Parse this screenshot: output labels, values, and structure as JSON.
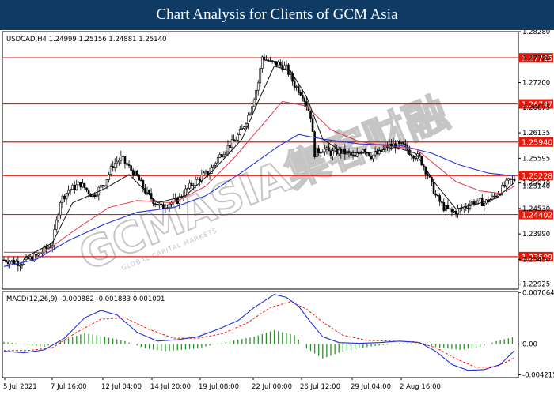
{
  "banner": {
    "title": "Chart Analysis for Clients of GCM Asia"
  },
  "watermark": {
    "brand": "GCMASIA集客财融",
    "tagline": "GLOBAL CAPITAL MARKETS"
  },
  "colors": {
    "banner_bg": "#0e3a63",
    "level_line": "#e8190b",
    "level_label_bg": "#e8190b",
    "ma_fast": "#111111",
    "ma_mid": "#e0364a",
    "ma_slow": "#2233dd",
    "macd_line": "#1e2fd9",
    "signal_line": "#e8190b",
    "histogram": "#1f9a1f",
    "candle": "#000000"
  },
  "chart_data": [
    {
      "type": "candlestick",
      "title": "USDCAD,H4",
      "info": "USDCAD,H4  1.24999 1.25156 1.24881 1.25140",
      "y_ticks": [
        "1.28280",
        "1.27720",
        "1.27200",
        "1.26675",
        "1.26135",
        "1.25595",
        "1.25070",
        "1.24530",
        "1.23990",
        "1.23450",
        "1.22925"
      ],
      "ylim": [
        1.2282,
        1.2828
      ],
      "x_ticks": [
        "5 Jul 2021",
        "7 Jul 16:00",
        "12 Jul 04:00",
        "14 Jul 20:00",
        "19 Jul 08:00",
        "22 Jul 00:00",
        "26 Jul 12:00",
        "29 Jul 04:00",
        "2 Aug 16:00"
      ],
      "levels": [
        {
          "label": "1.27725",
          "value": 1.27725
        },
        {
          "label": "1.26747",
          "value": 1.26747
        },
        {
          "label": "1.25940",
          "value": 1.2594
        },
        {
          "label": "1.25228",
          "value": 1.25228
        },
        {
          "label": "1.24402",
          "value": 1.24402
        },
        {
          "label": "1.23509",
          "value": 1.23509
        }
      ],
      "current_price_label": "1.25140",
      "close_path": [
        [
          0,
          1.2344
        ],
        [
          8,
          1.2338
        ],
        [
          16,
          1.2352
        ],
        [
          24,
          1.2378
        ],
        [
          28,
          1.247
        ],
        [
          32,
          1.2492
        ],
        [
          38,
          1.2505
        ],
        [
          44,
          1.248
        ],
        [
          50,
          1.2508
        ],
        [
          54,
          1.2545
        ],
        [
          58,
          1.256
        ],
        [
          62,
          1.254
        ],
        [
          66,
          1.252
        ],
        [
          70,
          1.249
        ],
        [
          74,
          1.247
        ],
        [
          78,
          1.2455
        ],
        [
          82,
          1.2465
        ],
        [
          86,
          1.247
        ],
        [
          90,
          1.249
        ],
        [
          94,
          1.2508
        ],
        [
          98,
          1.252
        ],
        [
          102,
          1.253
        ],
        [
          106,
          1.256
        ],
        [
          110,
          1.258
        ],
        [
          114,
          1.2595
        ],
        [
          118,
          1.262
        ],
        [
          122,
          1.266
        ],
        [
          126,
          1.272
        ],
        [
          128,
          1.2775
        ],
        [
          132,
          1.2762
        ],
        [
          136,
          1.276
        ],
        [
          140,
          1.275
        ],
        [
          144,
          1.2715
        ],
        [
          148,
          1.2695
        ],
        [
          152,
          1.265
        ],
        [
          154,
          1.257
        ],
        [
          158,
          1.258
        ],
        [
          162,
          1.257
        ],
        [
          166,
          1.2575
        ],
        [
          170,
          1.257
        ],
        [
          174,
          1.256
        ],
        [
          178,
          1.2582
        ],
        [
          182,
          1.2565
        ],
        [
          186,
          1.257
        ],
        [
          190,
          1.2585
        ],
        [
          194,
          1.2588
        ],
        [
          198,
          1.2585
        ],
        [
          202,
          1.257
        ],
        [
          206,
          1.256
        ],
        [
          210,
          1.2525
        ],
        [
          214,
          1.248
        ],
        [
          218,
          1.2455
        ],
        [
          222,
          1.2445
        ],
        [
          226,
          1.245
        ],
        [
          230,
          1.246
        ],
        [
          234,
          1.247
        ],
        [
          238,
          1.2465
        ],
        [
          242,
          1.2475
        ],
        [
          246,
          1.249
        ],
        [
          250,
          1.251
        ],
        [
          253,
          1.2514
        ]
      ],
      "ma_fast": [
        [
          10,
          1.2348
        ],
        [
          24,
          1.238
        ],
        [
          34,
          1.2465
        ],
        [
          50,
          1.2495
        ],
        [
          62,
          1.2525
        ],
        [
          76,
          1.2465
        ],
        [
          90,
          1.248
        ],
        [
          104,
          1.2535
        ],
        [
          118,
          1.26
        ],
        [
          126,
          1.268
        ],
        [
          134,
          1.2755
        ],
        [
          142,
          1.2745
        ],
        [
          150,
          1.269
        ],
        [
          158,
          1.26
        ],
        [
          168,
          1.2572
        ],
        [
          180,
          1.257
        ],
        [
          194,
          1.2583
        ],
        [
          204,
          1.257
        ],
        [
          214,
          1.2505
        ],
        [
          224,
          1.2452
        ],
        [
          234,
          1.2462
        ],
        [
          244,
          1.2475
        ],
        [
          253,
          1.2508
        ]
      ],
      "ma_mid": [
        [
          0,
          1.236
        ],
        [
          20,
          1.236
        ],
        [
          36,
          1.241
        ],
        [
          52,
          1.2455
        ],
        [
          66,
          1.247
        ],
        [
          84,
          1.2465
        ],
        [
          100,
          1.25
        ],
        [
          114,
          1.256
        ],
        [
          126,
          1.262
        ],
        [
          138,
          1.268
        ],
        [
          150,
          1.267
        ],
        [
          162,
          1.262
        ],
        [
          176,
          1.2595
        ],
        [
          190,
          1.2585
        ],
        [
          204,
          1.258
        ],
        [
          214,
          1.2545
        ],
        [
          224,
          1.251
        ],
        [
          236,
          1.249
        ],
        [
          246,
          1.2485
        ],
        [
          253,
          1.25
        ]
      ],
      "ma_slow": [
        [
          0,
          1.233
        ],
        [
          16,
          1.2345
        ],
        [
          32,
          1.2385
        ],
        [
          50,
          1.242
        ],
        [
          66,
          1.2445
        ],
        [
          84,
          1.2455
        ],
        [
          100,
          1.248
        ],
        [
          118,
          1.253
        ],
        [
          136,
          1.2585
        ],
        [
          146,
          1.261
        ],
        [
          158,
          1.26
        ],
        [
          176,
          1.259
        ],
        [
          196,
          1.2587
        ],
        [
          212,
          1.257
        ],
        [
          226,
          1.2545
        ],
        [
          240,
          1.2528
        ],
        [
          253,
          1.2522
        ]
      ]
    },
    {
      "type": "macd",
      "title": "MACD(12,26,9)",
      "info": "MACD(12,26,9) -0.000882 -0.001883 0.001001",
      "y_ticks": [
        "0.007064",
        "0.00",
        "-0.004215"
      ],
      "ylim": [
        -0.0046,
        0.0072
      ],
      "macd": [
        [
          0,
          -0.001
        ],
        [
          10,
          -0.0012
        ],
        [
          20,
          -0.0008
        ],
        [
          30,
          0.0008
        ],
        [
          40,
          0.0036
        ],
        [
          48,
          0.0046
        ],
        [
          56,
          0.004
        ],
        [
          66,
          0.0016
        ],
        [
          76,
          0.0004
        ],
        [
          86,
          0.0006
        ],
        [
          96,
          0.001
        ],
        [
          106,
          0.002
        ],
        [
          116,
          0.0032
        ],
        [
          124,
          0.005
        ],
        [
          134,
          0.0068
        ],
        [
          140,
          0.0064
        ],
        [
          146,
          0.0052
        ],
        [
          152,
          0.003
        ],
        [
          158,
          0.001
        ],
        [
          166,
          0.0002
        ],
        [
          176,
          0.0001
        ],
        [
          186,
          0.0002
        ],
        [
          196,
          0.0004
        ],
        [
          206,
          0.0002
        ],
        [
          214,
          -0.001
        ],
        [
          222,
          -0.0028
        ],
        [
          230,
          -0.0036
        ],
        [
          238,
          -0.0035
        ],
        [
          246,
          -0.0028
        ],
        [
          253,
          -0.0009
        ]
      ],
      "signal": [
        [
          0,
          -0.0009
        ],
        [
          12,
          -0.0009
        ],
        [
          24,
          -0.0005
        ],
        [
          36,
          0.0016
        ],
        [
          48,
          0.0034
        ],
        [
          60,
          0.0036
        ],
        [
          72,
          0.002
        ],
        [
          84,
          0.0008
        ],
        [
          96,
          0.0008
        ],
        [
          108,
          0.0014
        ],
        [
          120,
          0.0028
        ],
        [
          132,
          0.005
        ],
        [
          142,
          0.0058
        ],
        [
          150,
          0.0048
        ],
        [
          158,
          0.003
        ],
        [
          168,
          0.0012
        ],
        [
          180,
          0.0005
        ],
        [
          192,
          0.0004
        ],
        [
          204,
          0.0003
        ],
        [
          214,
          -0.0005
        ],
        [
          224,
          -0.002
        ],
        [
          234,
          -0.0032
        ],
        [
          244,
          -0.0031
        ],
        [
          253,
          -0.0019
        ]
      ],
      "histogram": [
        [
          0,
          0.0003
        ],
        [
          20,
          -0.0004
        ],
        [
          30,
          0.0006
        ],
        [
          40,
          0.0015
        ],
        [
          50,
          0.001
        ],
        [
          60,
          0.0004
        ],
        [
          70,
          -0.0006
        ],
        [
          80,
          -0.001
        ],
        [
          96,
          -0.0006
        ],
        [
          110,
          0.0003
        ],
        [
          124,
          0.001
        ],
        [
          134,
          0.0019
        ],
        [
          144,
          0.0012
        ],
        [
          150,
          -0.0006
        ],
        [
          158,
          -0.002
        ],
        [
          168,
          -0.001
        ],
        [
          180,
          -0.0004
        ],
        [
          196,
          0.0001
        ],
        [
          208,
          0.0001
        ],
        [
          216,
          -0.0005
        ],
        [
          226,
          -0.0008
        ],
        [
          236,
          -0.0004
        ],
        [
          244,
          0.0004
        ],
        [
          253,
          0.001
        ]
      ]
    }
  ]
}
